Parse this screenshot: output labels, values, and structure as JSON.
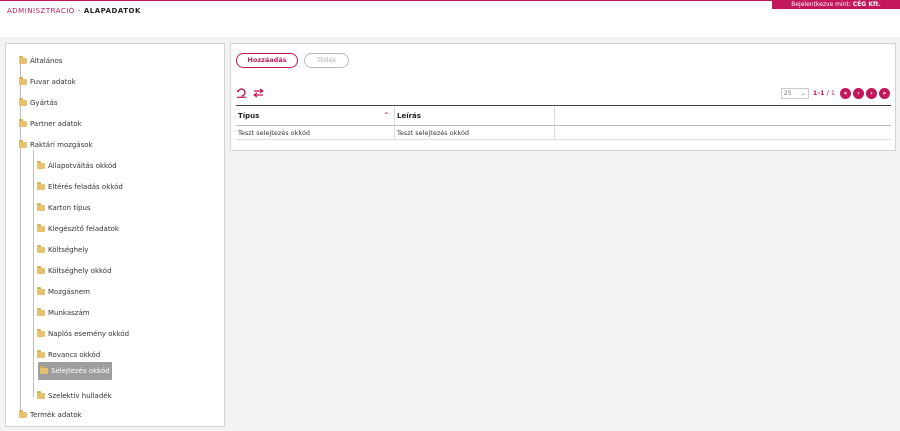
{
  "header": {
    "breadcrumb_section": "ADMINISZTRÁCIÓ",
    "breadcrumb_sep": "-",
    "breadcrumb_page": "ALAPADATOK",
    "login_prefix": "Bejelentkezve mint:",
    "login_user": "CÉG Kft."
  },
  "tree": {
    "roots": [
      {
        "label": "Általános"
      },
      {
        "label": "Fuvar adatok"
      },
      {
        "label": "Gyártás"
      },
      {
        "label": "Partner adatok"
      },
      {
        "label": "Raktári mozgások"
      },
      {
        "label": "Termék adatok"
      }
    ],
    "children": [
      {
        "label": "Állapotváltás okkód"
      },
      {
        "label": "Eltérés feladás okkód"
      },
      {
        "label": "Karton típus"
      },
      {
        "label": "Kiegészítő feladatok"
      },
      {
        "label": "Költséghely"
      },
      {
        "label": "Költséghely okkód"
      },
      {
        "label": "Mozgásnem"
      },
      {
        "label": "Munkaszám"
      },
      {
        "label": "Naplós esemény okkód"
      },
      {
        "label": "Rovancs okkód"
      },
      {
        "label": "Selejtezés okkód"
      },
      {
        "label": "Szelektív hulladék"
      }
    ],
    "selected": "Selejtezés okkód"
  },
  "toolbar": {
    "add_label": "Hozzáadás",
    "delete_label": "Törlés",
    "refresh_icon": "refresh-icon",
    "swap_icon": "swap-icon"
  },
  "pager": {
    "page_size": "25",
    "range": "1-1",
    "total": "/ 1",
    "first_icon": "first-page-icon",
    "prev_icon": "prev-page-icon",
    "next_icon": "next-page-icon",
    "last_icon": "last-page-icon"
  },
  "table": {
    "headers": [
      "Típus",
      "Leírás"
    ],
    "rows": [
      [
        "Teszt selejtezés okkód",
        "Teszt selejtezés okkód"
      ]
    ]
  },
  "colors": {
    "accent": "#c2185b",
    "selected_bg": "#9e9e9e",
    "folder": "#e6c26e"
  }
}
